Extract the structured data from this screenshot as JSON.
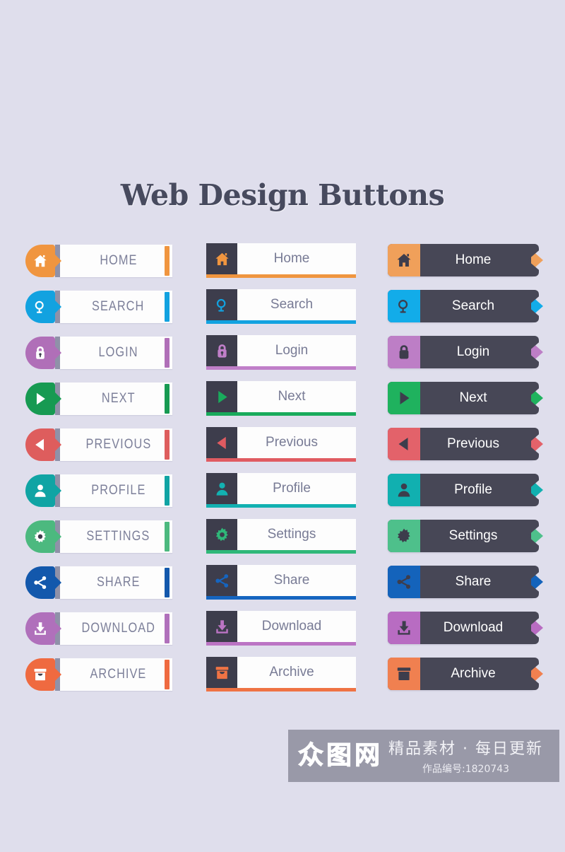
{
  "page": {
    "title": "Web Design Buttons",
    "background_color": "#dfdeec",
    "dark_color": "#474756",
    "tile_dark_color": "#3d3d4c",
    "label_muted_color": "#7c7f99"
  },
  "columns": [
    {
      "id": "col-1",
      "style": "light-split-pill",
      "buttons": [
        {
          "label": "HOME",
          "icon": "home-icon",
          "color": "#f0953f"
        },
        {
          "label": "SEARCH",
          "icon": "search-icon",
          "color": "#12a2e0"
        },
        {
          "label": "LOGIN",
          "icon": "lock-icon",
          "color": "#b06fb8"
        },
        {
          "label": "NEXT",
          "icon": "play-icon",
          "color": "#179a52"
        },
        {
          "label": "PREVIOUS",
          "icon": "back-icon",
          "color": "#de5d5d"
        },
        {
          "label": "PROFILE",
          "icon": "user-icon",
          "color": "#10a4a4"
        },
        {
          "label": "SETTINGS",
          "icon": "gear-icon",
          "color": "#4cb97f"
        },
        {
          "label": "SHARE",
          "icon": "share-icon",
          "color": "#1358ac"
        },
        {
          "label": "DOWNLOAD",
          "icon": "download-icon",
          "color": "#b070bb"
        },
        {
          "label": "ARCHIVE",
          "icon": "archive-icon",
          "color": "#ef6a40"
        }
      ]
    },
    {
      "id": "col-2",
      "style": "dark-tile-underline",
      "buttons": [
        {
          "label": "Home",
          "icon": "home-icon",
          "color": "#f0953f"
        },
        {
          "label": "Search",
          "icon": "search-icon",
          "color": "#12a2e0"
        },
        {
          "label": "Login",
          "icon": "lock-icon",
          "color": "#c07fc9"
        },
        {
          "label": "Next",
          "icon": "play-icon",
          "color": "#19ab5c"
        },
        {
          "label": "Previous",
          "icon": "back-icon",
          "color": "#e05b61"
        },
        {
          "label": "Profile",
          "icon": "user-icon",
          "color": "#12b1b1"
        },
        {
          "label": "Settings",
          "icon": "gear-icon",
          "color": "#2fb879"
        },
        {
          "label": "Share",
          "icon": "share-icon",
          "color": "#1565c0"
        },
        {
          "label": "Download",
          "icon": "download-icon",
          "color": "#bb74c4"
        },
        {
          "label": "Archive",
          "icon": "archive-icon",
          "color": "#ef7344"
        }
      ]
    },
    {
      "id": "col-3",
      "style": "dark-body-ribbon",
      "buttons": [
        {
          "label": "Home",
          "icon": "home-icon",
          "color": "#f0a05a"
        },
        {
          "label": "Search",
          "icon": "search-icon",
          "color": "#12ace9"
        },
        {
          "label": "Login",
          "icon": "lock-icon",
          "color": "#bd7ec6"
        },
        {
          "label": "Next",
          "icon": "play-icon",
          "color": "#1fb25e"
        },
        {
          "label": "Previous",
          "icon": "back-icon",
          "color": "#e3626a"
        },
        {
          "label": "Profile",
          "icon": "user-icon",
          "color": "#11b0b0"
        },
        {
          "label": "Settings",
          "icon": "gear-icon",
          "color": "#4ec08b"
        },
        {
          "label": "Share",
          "icon": "share-icon",
          "color": "#1463bb"
        },
        {
          "label": "Download",
          "icon": "download-icon",
          "color": "#b86cc2"
        },
        {
          "label": "Archive",
          "icon": "archive-icon",
          "color": "#f08050"
        }
      ]
    }
  ],
  "watermark": {
    "logo_chars": [
      "众",
      "图",
      "网"
    ],
    "tagline": "精品素材 · 每日更新",
    "work_id": "作品编号:1820743",
    "background_color": "#8a8a98"
  }
}
